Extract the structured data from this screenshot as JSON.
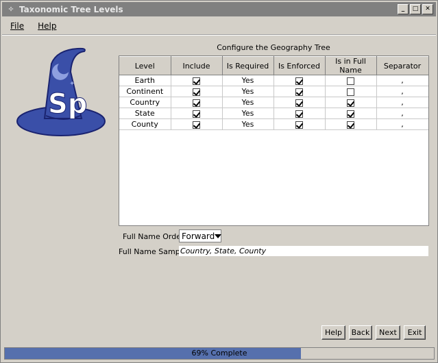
{
  "window": {
    "title": "Taxonomic Tree Levels"
  },
  "menu": {
    "file": "File",
    "help": "Help"
  },
  "caption": "Configure the Geography Tree",
  "table": {
    "columns": [
      "Level",
      "Include",
      "Is Required",
      "Is Enforced",
      "Is in Full Name",
      "Separator"
    ],
    "rows": [
      {
        "level": "Earth",
        "include": true,
        "required": "Yes",
        "enforced": true,
        "in_full_name": false,
        "separator": ","
      },
      {
        "level": "Continent",
        "include": true,
        "required": "Yes",
        "enforced": true,
        "in_full_name": false,
        "separator": ","
      },
      {
        "level": "Country",
        "include": true,
        "required": "Yes",
        "enforced": true,
        "in_full_name": true,
        "separator": ","
      },
      {
        "level": "State",
        "include": true,
        "required": "Yes",
        "enforced": true,
        "in_full_name": true,
        "separator": ","
      },
      {
        "level": "County",
        "include": true,
        "required": "Yes",
        "enforced": true,
        "in_full_name": true,
        "separator": ","
      }
    ]
  },
  "full_name_order": {
    "label": "Full Name Order:",
    "value": "Forward"
  },
  "full_name_sample": {
    "label": "Full Name Sample:",
    "value": "Country, State, County"
  },
  "buttons": {
    "help": "Help",
    "back": "Back",
    "next": "Next",
    "exit": "Exit"
  },
  "progress": {
    "label": "69% Complete",
    "fraction": 0.69
  },
  "colors": {
    "progress_fill": "#5670ad",
    "hat_blue": "#3a4fa8"
  },
  "icons": {
    "app": "specify-icon",
    "logo": "specify-wizard-hat-logo"
  },
  "logo_text": "Sp"
}
